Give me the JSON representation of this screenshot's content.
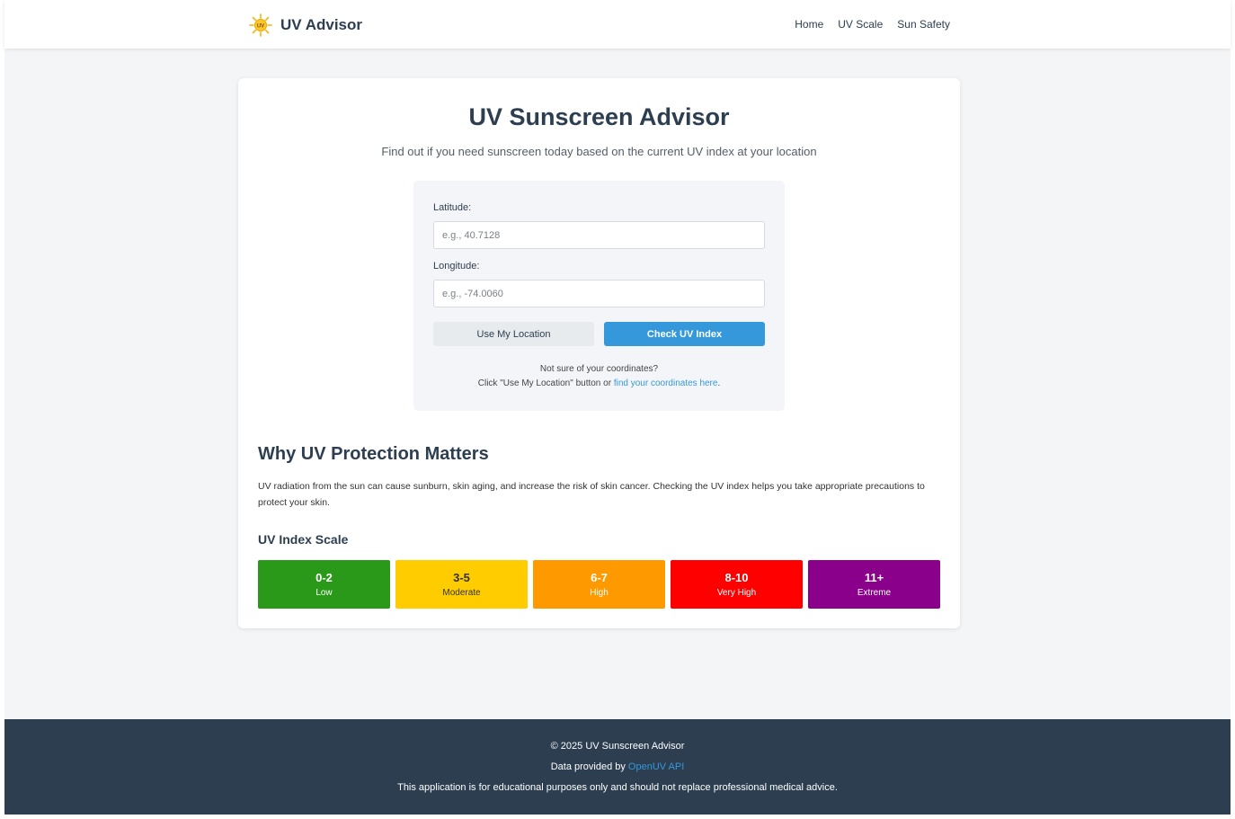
{
  "header": {
    "brand_name": "UV Advisor",
    "logo_text": "UV",
    "nav": [
      "Home",
      "UV Scale",
      "Sun Safety"
    ]
  },
  "main": {
    "title": "UV Sunscreen Advisor",
    "subtitle": "Find out if you need sunscreen today based on the current UV index at your location",
    "form": {
      "latitude_label": "Latitude:",
      "latitude_placeholder": "e.g., 40.7128",
      "latitude_value": "",
      "longitude_label": "Longitude:",
      "longitude_placeholder": "e.g., -74.0060",
      "longitude_value": "",
      "use_location_label": "Use My Location",
      "check_label": "Check UV Index",
      "hint_line1": "Not sure of your coordinates?",
      "hint_line2_prefix": "Click \"Use My Location\" button or ",
      "hint_link": "find your coordinates here",
      "hint_line2_suffix": "."
    },
    "why_title": "Why UV Protection Matters",
    "why_text": "UV radiation from the sun can cause sunburn, skin aging, and increase the risk of skin cancer. Checking the UV index helps you take appropriate precautions to protect your skin.",
    "scale_title": "UV Index Scale",
    "scale": [
      {
        "range": "0-2",
        "name": "Low",
        "color": "#2a9819",
        "text_color": "#ffffff"
      },
      {
        "range": "3-5",
        "name": "Moderate",
        "color": "#ffcc00",
        "text_color": "#333333"
      },
      {
        "range": "6-7",
        "name": "High",
        "color": "#ff9900",
        "text_color": "#ffffff"
      },
      {
        "range": "8-10",
        "name": "Very High",
        "color": "#ff0000",
        "text_color": "#ffffff"
      },
      {
        "range": "11+",
        "name": "Extreme",
        "color": "#8a008a",
        "text_color": "#ffffff"
      }
    ]
  },
  "footer": {
    "copyright": "© 2025 UV Sunscreen Advisor",
    "data_prefix": "Data provided by ",
    "data_link": "OpenUV API",
    "disclaimer": "This application is for educational purposes only and should not replace professional medical advice."
  },
  "colors": {
    "accent": "#3498db",
    "text_dark": "#2c3e50",
    "footer_bg": "#2c3e50"
  }
}
